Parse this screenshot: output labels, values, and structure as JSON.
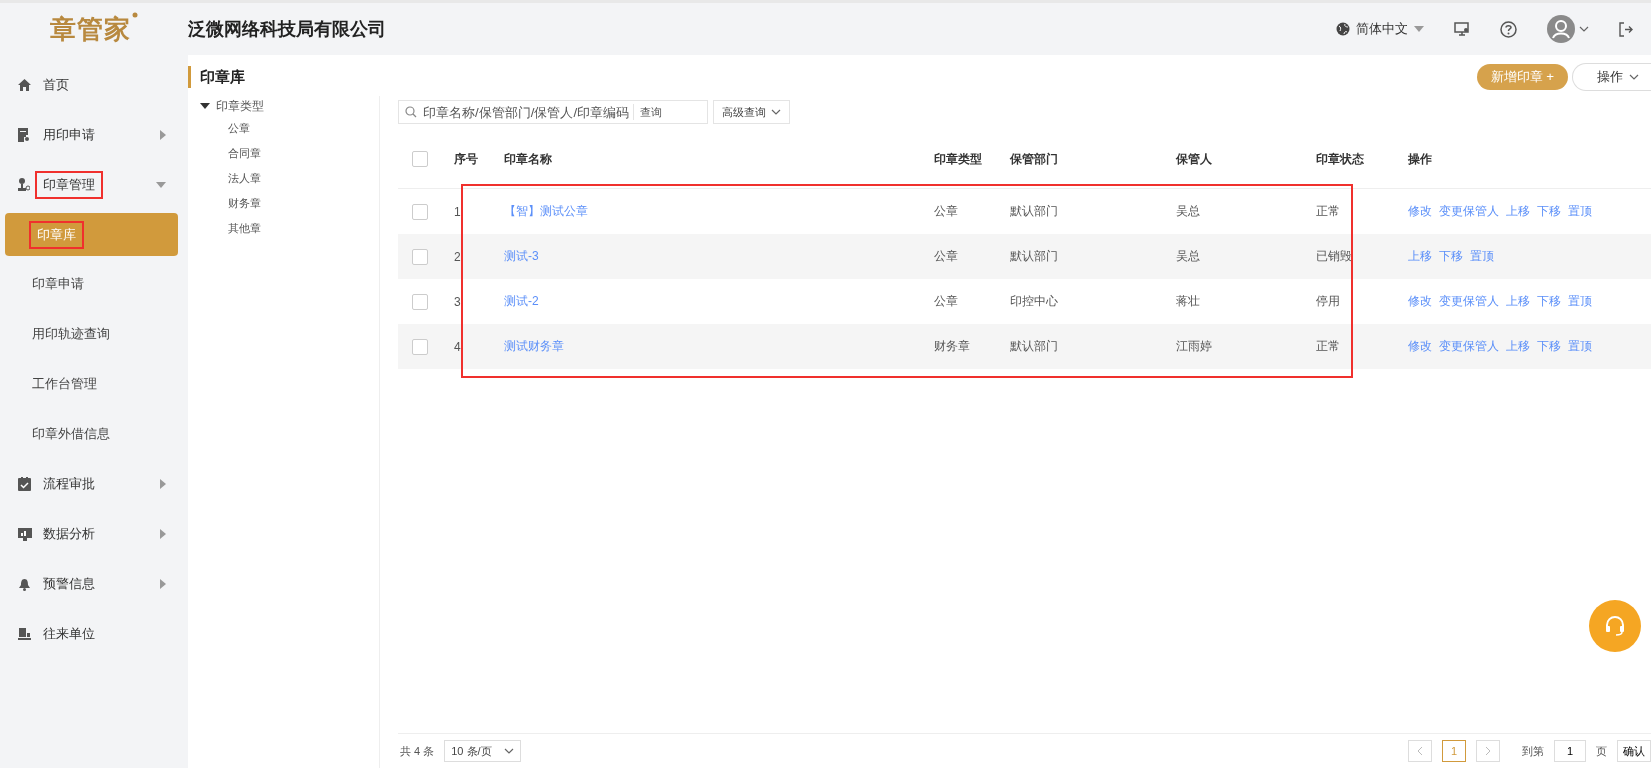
{
  "header": {
    "logo": "章管家",
    "company": "泛微网络科技局有限公司",
    "language": "简体中文"
  },
  "sidebar": {
    "items": [
      {
        "label": "首页",
        "kind": "link",
        "highlighted": false
      },
      {
        "label": "用印申请",
        "kind": "group",
        "expanded": false,
        "highlighted": false
      },
      {
        "label": "印章管理",
        "kind": "group",
        "expanded": true,
        "highlighted": true,
        "children": [
          {
            "label": "印章库",
            "selected": true,
            "highlighted": true
          },
          {
            "label": "印章申请",
            "selected": false,
            "highlighted": false
          },
          {
            "label": "用印轨迹查询",
            "selected": false,
            "highlighted": false
          },
          {
            "label": "工作台管理",
            "selected": false,
            "highlighted": false
          },
          {
            "label": "印章外借信息",
            "selected": false,
            "highlighted": false
          }
        ]
      },
      {
        "label": "流程审批",
        "kind": "group",
        "expanded": false,
        "highlighted": false
      },
      {
        "label": "数据分析",
        "kind": "group",
        "expanded": false,
        "highlighted": false
      },
      {
        "label": "预警信息",
        "kind": "group",
        "expanded": false,
        "highlighted": false
      },
      {
        "label": "往来单位",
        "kind": "link",
        "highlighted": false
      }
    ]
  },
  "page_title": "印章库",
  "actions": {
    "primary": "新增印章 +",
    "secondary": "操作"
  },
  "tree": {
    "label": "印章类型",
    "expanded": true,
    "children": [
      {
        "label": "公章"
      },
      {
        "label": "合同章"
      },
      {
        "label": "法人章"
      },
      {
        "label": "财务章"
      },
      {
        "label": "其他章"
      }
    ]
  },
  "search": {
    "placeholder": "印章名称/保管部门/保管人/印章编码",
    "button": "查询",
    "advanced": "高级查询"
  },
  "table": {
    "select_all_checked": false,
    "highlight_rows": true,
    "columns": [
      "序号",
      "印章名称",
      "印章类型",
      "保管部门",
      "保管人",
      "印章状态",
      "操作"
    ],
    "rows": [
      {
        "checked": false,
        "no": "1",
        "name": "【智】测试公章",
        "type": "公章",
        "dept": "默认部门",
        "keeper": "吴总",
        "status": "正常",
        "ops": [
          "修改",
          "变更保管人",
          "上移",
          "下移",
          "置顶"
        ]
      },
      {
        "checked": false,
        "no": "2",
        "name": "测试-3",
        "type": "公章",
        "dept": "默认部门",
        "keeper": "吴总",
        "status": "已销毁",
        "ops": [
          "上移",
          "下移",
          "置顶"
        ]
      },
      {
        "checked": false,
        "no": "3",
        "name": "测试-2",
        "type": "公章",
        "dept": "印控中心",
        "keeper": "蒋壮",
        "status": "停用",
        "ops": [
          "修改",
          "变更保管人",
          "上移",
          "下移",
          "置顶"
        ]
      },
      {
        "checked": false,
        "no": "4",
        "name": "测试财务章",
        "type": "财务章",
        "dept": "默认部门",
        "keeper": "江雨婷",
        "status": "正常",
        "ops": [
          "修改",
          "变更保管人",
          "上移",
          "下移",
          "置顶"
        ]
      }
    ]
  },
  "pagination": {
    "total": "共 4 条",
    "page_size": "10 条/页",
    "pages": [
      {
        "label": "1",
        "selected": true
      }
    ],
    "goto_prefix": "到第",
    "goto_value": "1",
    "goto_suffix": "页",
    "confirm": "确认"
  }
}
